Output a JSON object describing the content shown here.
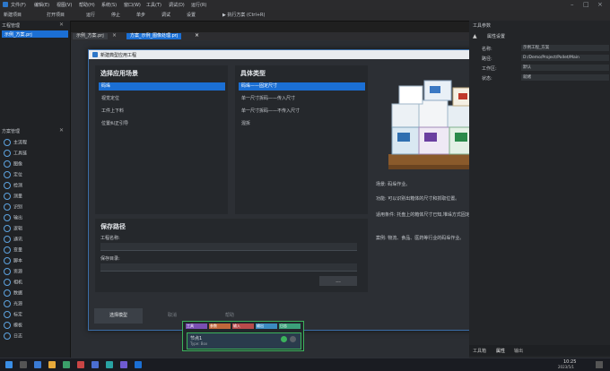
{
  "menubar": {
    "items": [
      "文件(F)",
      "编辑(E)",
      "视图(V)",
      "帮助(H)",
      "系统(S)",
      "窗口(W)",
      "工具(T)",
      "调试(D)",
      "运行(R)"
    ]
  },
  "toolbar": {
    "items": [
      "新建项目",
      "打开项目",
      "运行",
      "停止",
      "单步",
      "调试",
      "设置",
      "▶ 执行方案 (Ctrl+R)"
    ]
  },
  "left_pane": {
    "title": "工程管理",
    "tab": "示例_方案.prj",
    "section_title": "方案管理",
    "items": [
      "主流程",
      "工具链",
      "图像",
      "定位",
      "检测",
      "测量",
      "识别",
      "输出",
      "逻辑",
      "通讯",
      "变量",
      "脚本",
      "资源",
      "相机",
      "数据",
      "光源",
      "标定",
      "模板",
      "日志"
    ]
  },
  "doc_tabs": [
    "示例_方案.prj",
    "方案_示例_图像处理.prj"
  ],
  "dialog": {
    "title": "新建典型应用工程",
    "section_scene": "选择应用场景",
    "section_type": "具体类型",
    "scenes": [
      "码垛",
      "视觉定位",
      "工件上下料",
      "位置纠正引导"
    ],
    "types": [
      "码垛——固定尺寸",
      "单一尺寸拆码——传入尺寸",
      "单一尺寸拆码——不传入尺寸",
      "混拆"
    ],
    "section_save": "保存路径",
    "project_name_label": "工程名称:",
    "save_dir_label": "保存目录:",
    "browse_label": "...",
    "desc": {
      "scene": "场景: 码垛作业。",
      "function": "功能: 可以识别出箱体的尺寸和抓取位置。",
      "applicable": "适用条件: 托盘上的箱体尺寸已知,堆垛方式固定。",
      "case": "案例: 物流、食品、医药等行业的码垛作业。"
    },
    "buttons": {
      "ok": "选择模型",
      "cancel": "取消",
      "help": "帮助"
    }
  },
  "node": {
    "tabs": [
      "工具",
      "参数",
      "输入",
      "输出",
      "日志"
    ],
    "title": "节点1",
    "sub": "Type: Box"
  },
  "right_pane": {
    "title": "工具参数",
    "heading": "属性设置",
    "rows": [
      {
        "label": "名称:",
        "value": "示例工程_方案"
      },
      {
        "label": "路径:",
        "value": "D:/Demo/Project/Pallet/Main"
      },
      {
        "label": "工作区:",
        "value": "默认"
      },
      {
        "label": "状态:",
        "value": "就绪"
      }
    ],
    "bottom_tabs": [
      "工具箱",
      "属性",
      "输出"
    ]
  },
  "taskbar": {
    "time": "10:25",
    "date": "2023/5/1"
  },
  "colors": {
    "accent": "#1b6fd4",
    "node_border": "#3bb35c"
  }
}
